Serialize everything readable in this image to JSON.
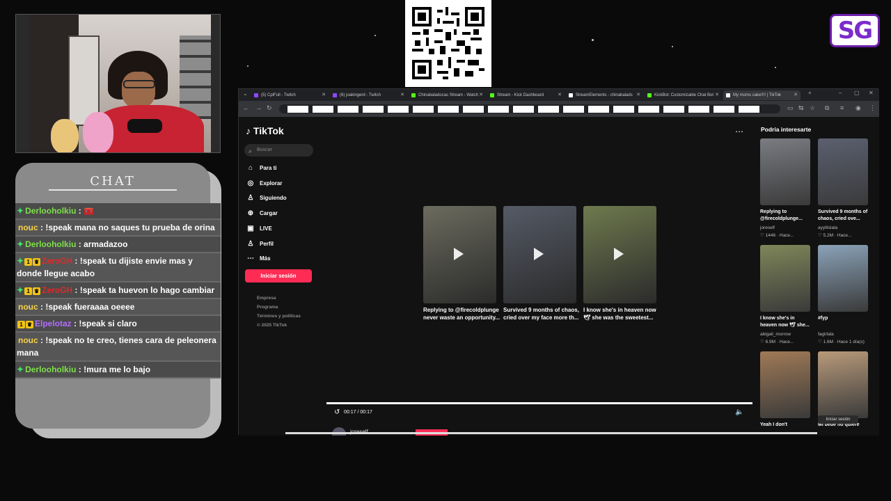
{
  "overlay": {
    "chat_title": "CHAT",
    "logo_text": "SG",
    "chat_messages": [
      {
        "user": "Derlooholkiu",
        "user_color": "green",
        "badges": "diamond",
        "text": " : 🧰"
      },
      {
        "user": "nouc",
        "user_color": "yellow",
        "badges": "",
        "text": " : !speak mana no saques tu prueba de orina"
      },
      {
        "user": "Derlooholkiu",
        "user_color": "green",
        "badges": "diamond",
        "text": " : armadazoo"
      },
      {
        "user": "ZeroGH",
        "user_color": "red",
        "badges": "diamond-1-crown",
        "text": " : !speak tu dijiste envie mas y donde llegue acabo"
      },
      {
        "user": "ZeroGH",
        "user_color": "red",
        "badges": "diamond-1-crown",
        "text": " : !speak ta huevon lo hago cambiar"
      },
      {
        "user": "nouc",
        "user_color": "yellow",
        "badges": "",
        "text": " : !speak fueraaaa oeeee"
      },
      {
        "user": "Elpelotaz",
        "user_color": "purple",
        "badges": "1-crown",
        "text": " : !speak si claro"
      },
      {
        "user": "nouc",
        "user_color": "yellow",
        "badges": "",
        "text": " : !speak no te creo, tienes cara de peleonera mana"
      },
      {
        "user": "Derlooholkiu",
        "user_color": "green",
        "badges": "diamond",
        "text": " : !mura me lo bajo"
      }
    ]
  },
  "browser": {
    "tabs": [
      {
        "label": "(5) CplFull - Twitch",
        "color": "#9146ff"
      },
      {
        "label": "(6) joakingerd - Twitch",
        "color": "#9146ff"
      },
      {
        "label": "Chinabaladocas Stream - Watch",
        "color": "#53fc18"
      },
      {
        "label": "Stream - Kick Dashboard",
        "color": "#53fc18"
      },
      {
        "label": "StreamElements - chinabalads",
        "color": "#ffffff"
      },
      {
        "label": "KickBot: Customizable Chat Bot",
        "color": "#53fc18"
      },
      {
        "label": "My moms cake!!!! | TikTok",
        "color": "#ffffff"
      }
    ]
  },
  "tiktok": {
    "logo": "TikTok",
    "search_placeholder": "Buscar",
    "nav": [
      {
        "label": "Para ti",
        "icon": "home-icon",
        "glyph": "⌂"
      },
      {
        "label": "Explorar",
        "icon": "compass-icon",
        "glyph": "◎"
      },
      {
        "label": "Siguiendo",
        "icon": "following-icon",
        "glyph": "♙"
      },
      {
        "label": "Cargar",
        "icon": "upload-icon",
        "glyph": "⊕"
      },
      {
        "label": "LIVE",
        "icon": "live-icon",
        "glyph": "▣"
      },
      {
        "label": "Perfil",
        "icon": "profile-icon",
        "glyph": "♙"
      },
      {
        "label": "Más",
        "icon": "more-icon",
        "glyph": "⋯"
      }
    ],
    "login_button": "Iniciar sesión",
    "footer": [
      "Empresa",
      "Programa",
      "Términos y políticas",
      "© 2025 TikTok"
    ],
    "feed": [
      {
        "caption": "Replying to @firecoldplunge never waste an opportunity...",
        "bg": "#6b6b5e"
      },
      {
        "caption": "Survived 9 months of chaos, cried over my face more th...",
        "bg": "#555a66"
      },
      {
        "caption": "I know she's in heaven now 🕊 she was the sweetest...",
        "bg": "#6f7a4e"
      }
    ],
    "time": "00:17 / 00:17",
    "author": "joreself",
    "sidebar_title": "Podría interesarte",
    "sidebar": [
      {
        "caption": "Replying to @firecoldplunge...",
        "user": "joreself",
        "stats": "♡ 1446 · Hace...",
        "bg": "#7a7c82"
      },
      {
        "caption": "Survived 9 months of chaos, cried ove...",
        "user": "ayylitslala",
        "stats": "♡ 5.2M · Hace...",
        "bg": "#5b6070"
      },
      {
        "caption": "I know she's in heaven now 🕊 she...",
        "user": "abigail_morrow",
        "stats": "♡ 6.9M · Hace...",
        "bg": "#7f8659"
      },
      {
        "caption": "#fyp",
        "user": "fagirlala",
        "stats": "♡ 1.6M · Hace 1 día(s)",
        "bg": "#8aa2b8"
      },
      {
        "caption": "Yeah I don't",
        "user": "",
        "stats": "",
        "bg": "#a07a56"
      },
      {
        "caption": "Mi bebé no quiere",
        "user": "",
        "stats": "",
        "bg": "#b89a7a"
      }
    ],
    "login_pill": "Iniciar sesión"
  }
}
